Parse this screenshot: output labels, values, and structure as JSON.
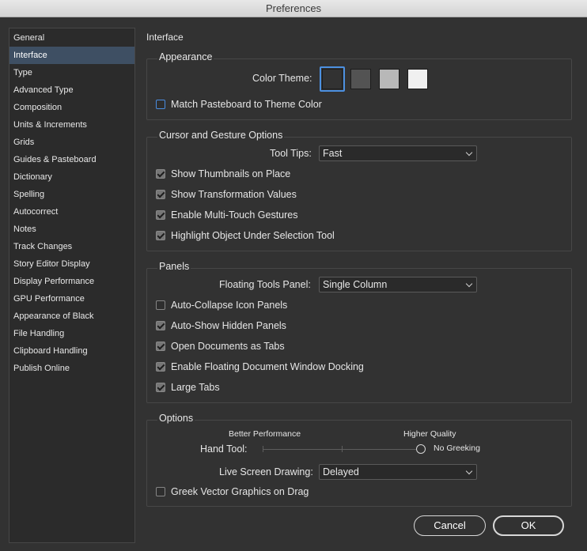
{
  "window": {
    "title": "Preferences"
  },
  "sidebar": {
    "items": [
      {
        "label": "General"
      },
      {
        "label": "Interface",
        "selected": true
      },
      {
        "label": "Type"
      },
      {
        "label": "Advanced Type"
      },
      {
        "label": "Composition"
      },
      {
        "label": "Units & Increments"
      },
      {
        "label": "Grids"
      },
      {
        "label": "Guides & Pasteboard"
      },
      {
        "label": "Dictionary"
      },
      {
        "label": "Spelling"
      },
      {
        "label": "Autocorrect"
      },
      {
        "label": "Notes"
      },
      {
        "label": "Track Changes"
      },
      {
        "label": "Story Editor Display"
      },
      {
        "label": "Display Performance"
      },
      {
        "label": "GPU Performance"
      },
      {
        "label": "Appearance of Black"
      },
      {
        "label": "File Handling"
      },
      {
        "label": "Clipboard Handling"
      },
      {
        "label": "Publish Online"
      }
    ]
  },
  "page": {
    "title": "Interface"
  },
  "appearance": {
    "title": "Appearance",
    "color_theme_label": "Color Theme:",
    "themes": [
      {
        "color": "#323232",
        "selected": true
      },
      {
        "color": "#535353",
        "selected": false
      },
      {
        "color": "#b8b8b8",
        "selected": false
      },
      {
        "color": "#f0f0f0",
        "selected": false
      }
    ],
    "match_pasteboard": {
      "label": "Match Pasteboard to Theme Color",
      "checked": false
    }
  },
  "cursor": {
    "title": "Cursor and Gesture Options",
    "tooltips_label": "Tool Tips:",
    "tooltips_value": "Fast",
    "options": [
      {
        "label": "Show Thumbnails on Place",
        "checked": true
      },
      {
        "label": "Show Transformation Values",
        "checked": true
      },
      {
        "label": "Enable Multi-Touch Gestures",
        "checked": true
      },
      {
        "label": "Highlight Object Under Selection Tool",
        "checked": true
      }
    ]
  },
  "panels": {
    "title": "Panels",
    "floating_label": "Floating Tools Panel:",
    "floating_value": "Single Column",
    "options": [
      {
        "label": "Auto-Collapse Icon Panels",
        "checked": false
      },
      {
        "label": "Auto-Show Hidden Panels",
        "checked": true
      },
      {
        "label": "Open Documents as Tabs",
        "checked": true
      },
      {
        "label": "Enable Floating Document Window Docking",
        "checked": true
      },
      {
        "label": "Large Tabs",
        "checked": true
      }
    ]
  },
  "options": {
    "title": "Options",
    "better_label": "Better Performance",
    "higher_label": "Higher Quality",
    "hand_tool_label": "Hand Tool:",
    "hand_tool_value_label": "No Greeking",
    "hand_tool_level": 1.0,
    "live_label": "Live Screen Drawing:",
    "live_value": "Delayed",
    "greek_vector": {
      "label": "Greek Vector Graphics on Drag",
      "checked": false
    }
  },
  "buttons": {
    "cancel": "Cancel",
    "ok": "OK"
  },
  "colors": {
    "accent": "#4c90e0",
    "selection": "#3e4f63",
    "background": "#323232"
  }
}
